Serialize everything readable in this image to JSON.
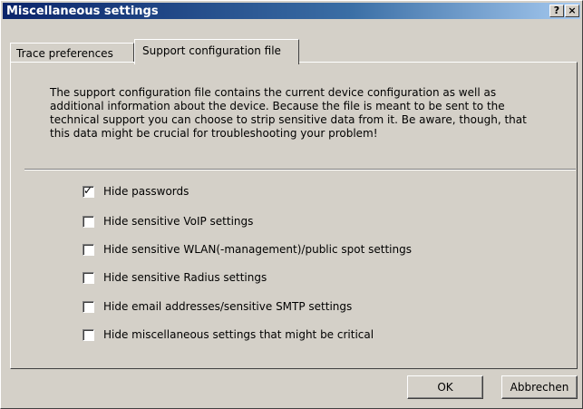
{
  "window": {
    "title": "Miscellaneous settings",
    "help_label": "?",
    "close_label": "×"
  },
  "tabs": [
    {
      "label": "Trace preferences",
      "active": false
    },
    {
      "label": "Support configuration file",
      "active": true
    }
  ],
  "content": {
    "description": "The support configuration file contains the current device configuration as well as additional information about the device. Because the file is meant to be sent to the technical support you can choose to strip sensitive data from it. Be aware, though, that this data might be crucial for troubleshooting your problem!",
    "options": [
      {
        "label": "Hide passwords",
        "checked": true
      },
      {
        "label": "Hide sensitive VoIP settings",
        "checked": false
      },
      {
        "label": "Hide sensitive WLAN(-management)/public spot settings",
        "checked": false
      },
      {
        "label": "Hide sensitive Radius settings",
        "checked": false
      },
      {
        "label": "Hide email addresses/sensitive SMTP settings",
        "checked": false
      },
      {
        "label": "Hide miscellaneous settings that might be critical",
        "checked": false
      }
    ]
  },
  "buttons": {
    "ok": "OK",
    "cancel": "Abbrechen"
  }
}
